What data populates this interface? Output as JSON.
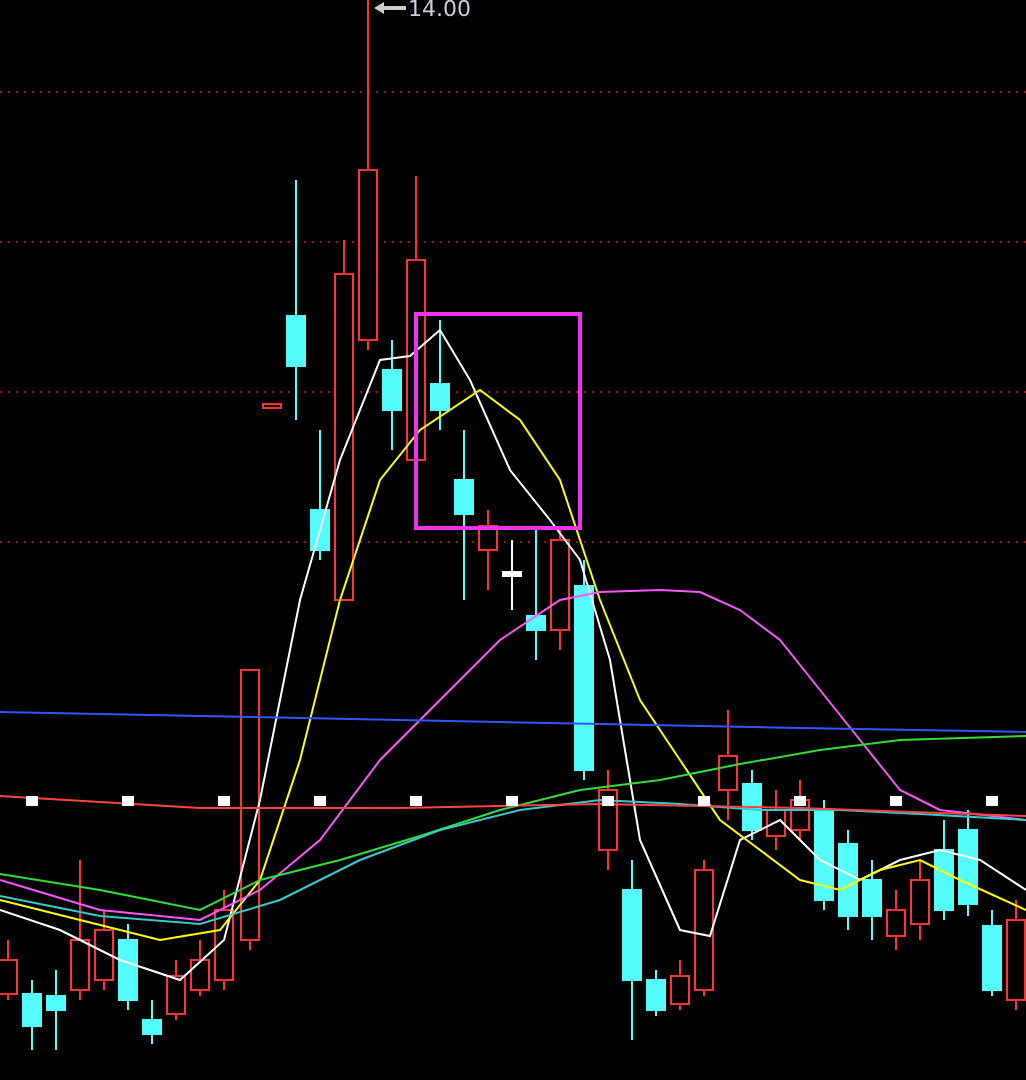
{
  "chart": {
    "high_price_label": "14.00"
  }
}
